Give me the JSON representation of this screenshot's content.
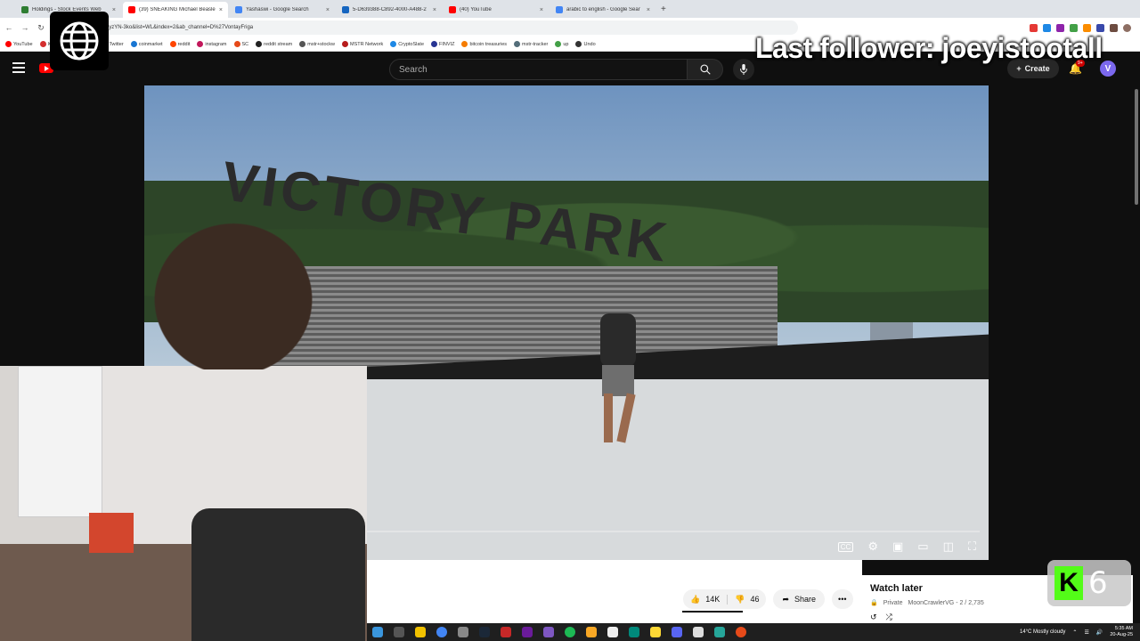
{
  "browser": {
    "tabs": [
      {
        "title": "Holdings - Stock Events Web",
        "color": "#2e7d32"
      },
      {
        "title": "(39) SNEAKING Michael Beasle",
        "color": "#ff0000",
        "active": true
      },
      {
        "title": "Yashaswi - Google Search",
        "color": "#4285f4"
      },
      {
        "title": "5-D639388-C892-4000-A488-2",
        "color": "#1565c0"
      },
      {
        "title": "(40) YouTube",
        "color": "#ff0000"
      },
      {
        "title": "arabic to english - Google Sear",
        "color": "#4285f4"
      }
    ],
    "url": "watch?v=1B6yzYN-3ko&list=WL&index=2&ab_channel=D%27VontayFriga",
    "bookmarks": [
      {
        "label": "YouTube",
        "color": "#ff0000"
      },
      {
        "label": "IGN",
        "color": "#d32f2f"
      },
      {
        "label": "flashscore",
        "color": "#333333"
      },
      {
        "label": "Twitter",
        "color": "#111111"
      },
      {
        "label": "coinmarket",
        "color": "#1976d2"
      },
      {
        "label": "reddit",
        "color": "#ff4500"
      },
      {
        "label": "instagram",
        "color": "#c2185b"
      },
      {
        "label": "SC",
        "color": "#e64a19"
      },
      {
        "label": "reddit stream",
        "color": "#222222"
      },
      {
        "label": "mstr+stockw",
        "color": "#555555"
      },
      {
        "label": "MSTR Network",
        "color": "#b71c1c"
      },
      {
        "label": "CryptoSlate",
        "color": "#1e88e5"
      },
      {
        "label": "FINVIZ",
        "color": "#283593"
      },
      {
        "label": "bitcoin treasuries",
        "color": "#f57c00"
      },
      {
        "label": "mstr-tracker",
        "color": "#546e7a"
      },
      {
        "label": "up",
        "color": "#43a047"
      },
      {
        "label": "Undo",
        "color": "#333333"
      }
    ]
  },
  "youtube": {
    "search_placeholder": "Search",
    "create_label": "Create",
    "notif_count": "9+",
    "avatar_letter": "V",
    "likes": "14K",
    "dislikes": "46",
    "share_label": "Share",
    "more_label": "•••"
  },
  "playlist": {
    "title": "Watch later",
    "privacy": "Private",
    "channel_position": "MoonCrawlerVG - 2 / 2,735"
  },
  "video": {
    "sign_text": "VICTORY PARK",
    "cc_label": "CC"
  },
  "overlay": {
    "follower_text": "Last follower: joeyistootall",
    "kick_letter": "K",
    "kick_count": "6"
  },
  "taskbar": {
    "weather": "14°C  Mostly cloudy",
    "time": "5:35 AM",
    "date": "20-Aug-25"
  },
  "colors": {
    "yt_bg": "#0f0f0f",
    "yt_red": "#ff0000",
    "kick_green": "#53fc18"
  }
}
